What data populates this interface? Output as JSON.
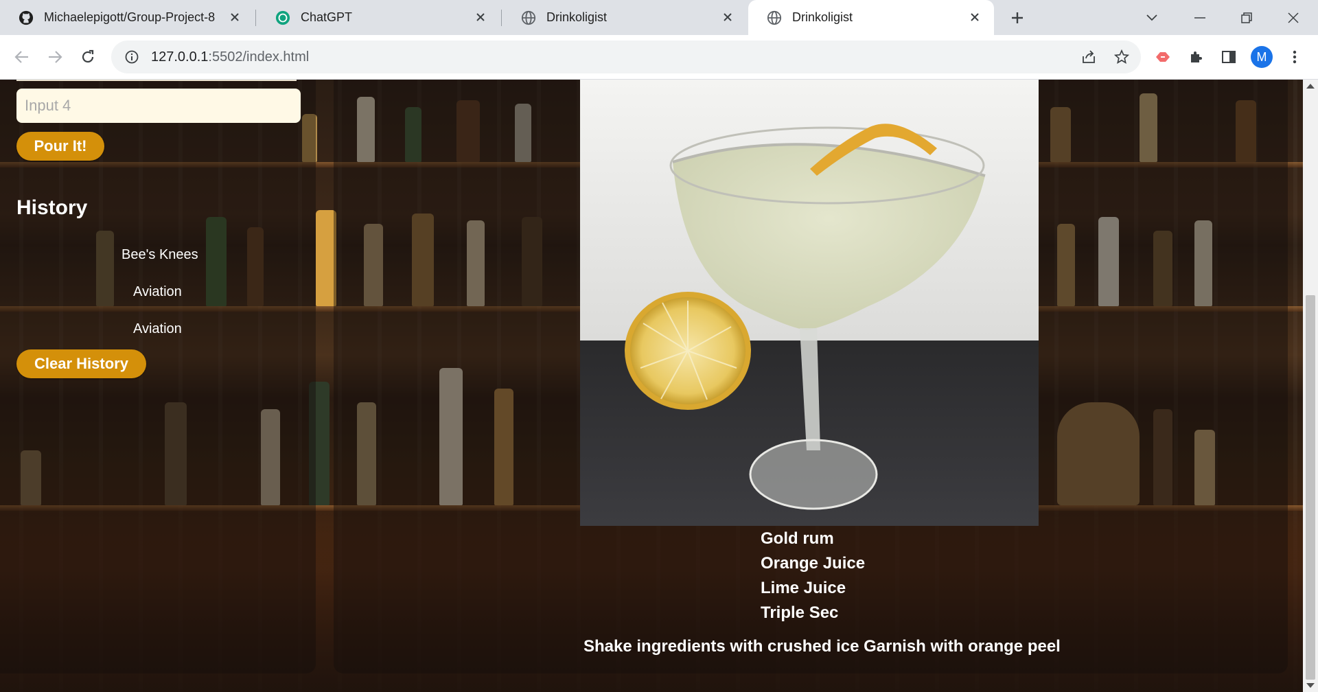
{
  "browser": {
    "tabs": [
      {
        "title": "Michaelepigott/Group-Project-8",
        "icon": "github-icon",
        "active": false
      },
      {
        "title": "ChatGPT",
        "icon": "chatgpt-icon",
        "active": false
      },
      {
        "title": "Drinkoligist",
        "icon": "globe-icon",
        "active": false
      },
      {
        "title": "Drinkoligist",
        "icon": "globe-icon",
        "active": true
      }
    ],
    "url_host": "127.0.0.1",
    "url_rest": ":5502/index.html",
    "profile_initial": "M"
  },
  "sidebar": {
    "input4_placeholder": "Input 4",
    "pour_button": "Pour It!",
    "history_title": "History",
    "history_items": [
      "Bee's Knees",
      "Aviation",
      "Aviation"
    ],
    "clear_button": "Clear History"
  },
  "drink": {
    "ingredients": [
      "Gold rum",
      "Orange Juice",
      "Lime Juice",
      "Triple Sec"
    ],
    "instructions": "Shake ingredients with crushed ice Garnish with orange peel"
  },
  "colors": {
    "accent_button": "#d4900a",
    "input_bg": "#fff9e6"
  }
}
